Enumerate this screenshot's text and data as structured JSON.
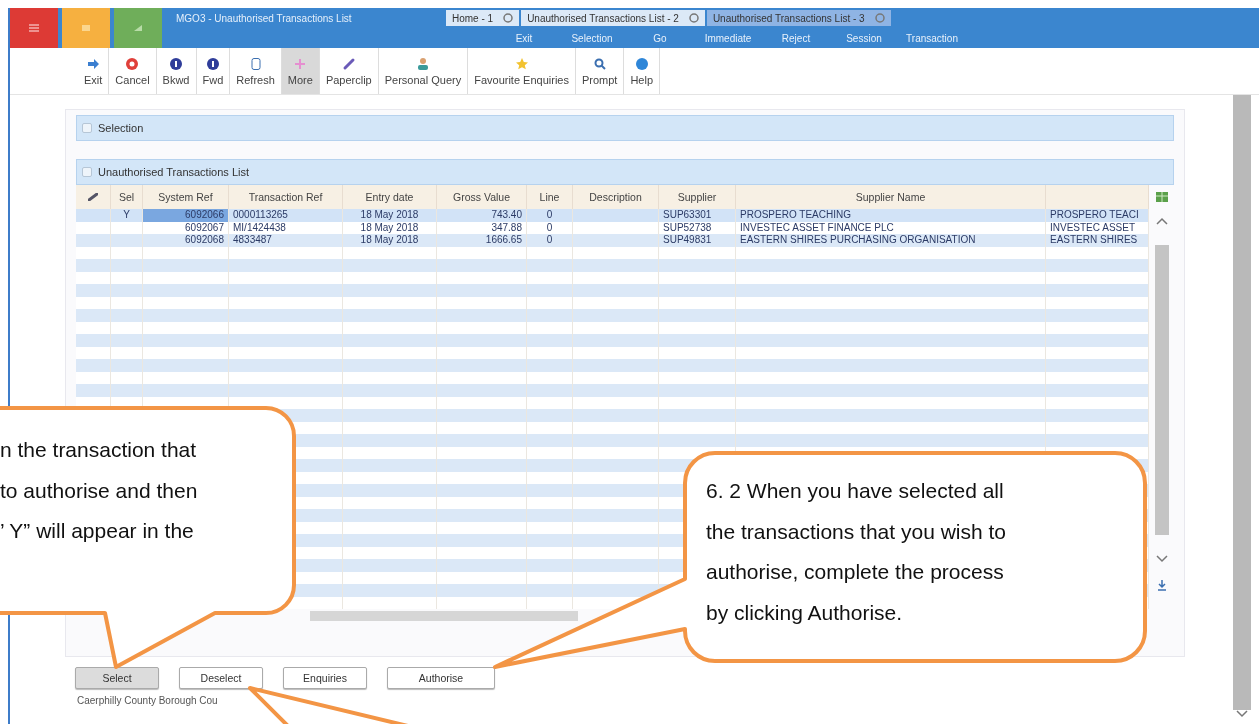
{
  "header": {
    "title": "MGO3 - Unauthorised Transactions List",
    "tabs": [
      {
        "label": "Home - 1",
        "selected": false
      },
      {
        "label": "Unauthorised Transactions List - 2",
        "selected": false
      },
      {
        "label": "Unauthorised Transactions List - 3",
        "selected": true
      }
    ],
    "menu": [
      "Exit",
      "Selection",
      "Go",
      "Immediate",
      "Reject",
      "Session",
      "Transaction"
    ]
  },
  "toolbar": [
    {
      "label": "Exit",
      "selected": false
    },
    {
      "label": "Cancel",
      "selected": false
    },
    {
      "label": "Bkwd",
      "selected": false
    },
    {
      "label": "Fwd",
      "selected": false
    },
    {
      "label": "Refresh",
      "selected": false
    },
    {
      "label": "More",
      "selected": true
    },
    {
      "label": "Paperclip",
      "selected": false
    },
    {
      "label": "Personal Query",
      "selected": false
    },
    {
      "label": "Favourite Enquiries",
      "selected": false
    },
    {
      "label": "Prompt",
      "selected": false
    },
    {
      "label": "Help",
      "selected": false
    }
  ],
  "selection_panel": {
    "title": "Selection"
  },
  "list_panel": {
    "title": "Unauthorised Transactions List"
  },
  "table": {
    "columns": [
      "Sel",
      "System Ref",
      "Transaction Ref",
      "Entry date",
      "Gross Value",
      "Line",
      "Description",
      "Supplier",
      "Supplier Name"
    ],
    "rows": [
      {
        "selected": true,
        "sel": "Y",
        "system_ref": "6092066",
        "transaction_ref": "0000113265",
        "entry_date": "18 May 2018",
        "gross_value": "743.40",
        "line": "0",
        "supplier": "SUP63301",
        "supplier_name": "PROSPERO TEACHING",
        "column_11": "PROSPERO TEACI"
      },
      {
        "selected": false,
        "system_ref": "6092067",
        "transaction_ref": "MI/1424438",
        "entry_date": "18 May 2018",
        "gross_value": "347.88",
        "line": "0",
        "supplier": "SUP52738",
        "supplier_name": "INVESTEC ASSET FINANCE PLC",
        "column_11": "INVESTEC ASSET"
      },
      {
        "selected": false,
        "system_ref": "6092068",
        "transaction_ref": "4833487",
        "entry_date": "18 May 2018",
        "gross_value": "1666.65",
        "line": "0",
        "supplier": "SUP49831",
        "supplier_name": "EASTERN SHIRES PURCHASING ORGANISATION",
        "column_11": "EASTERN SHIRES"
      }
    ]
  },
  "buttons": [
    {
      "label": "Select",
      "pressed": true
    },
    {
      "label": "Deselect",
      "pressed": false
    },
    {
      "label": "Enquiries",
      "pressed": false
    },
    {
      "label": "Authorise",
      "pressed": false
    }
  ],
  "footer": "Caerphilly County Borough Cou",
  "callouts": [
    {
      "text": "n the transaction that\nto authorise and then\n’ Y” will appear in the"
    },
    {
      "text": "6. 2 When you have selected all\nthe transactions that you wish to\nauthorise, complete the process\nby clicking Authorise."
    }
  ]
}
